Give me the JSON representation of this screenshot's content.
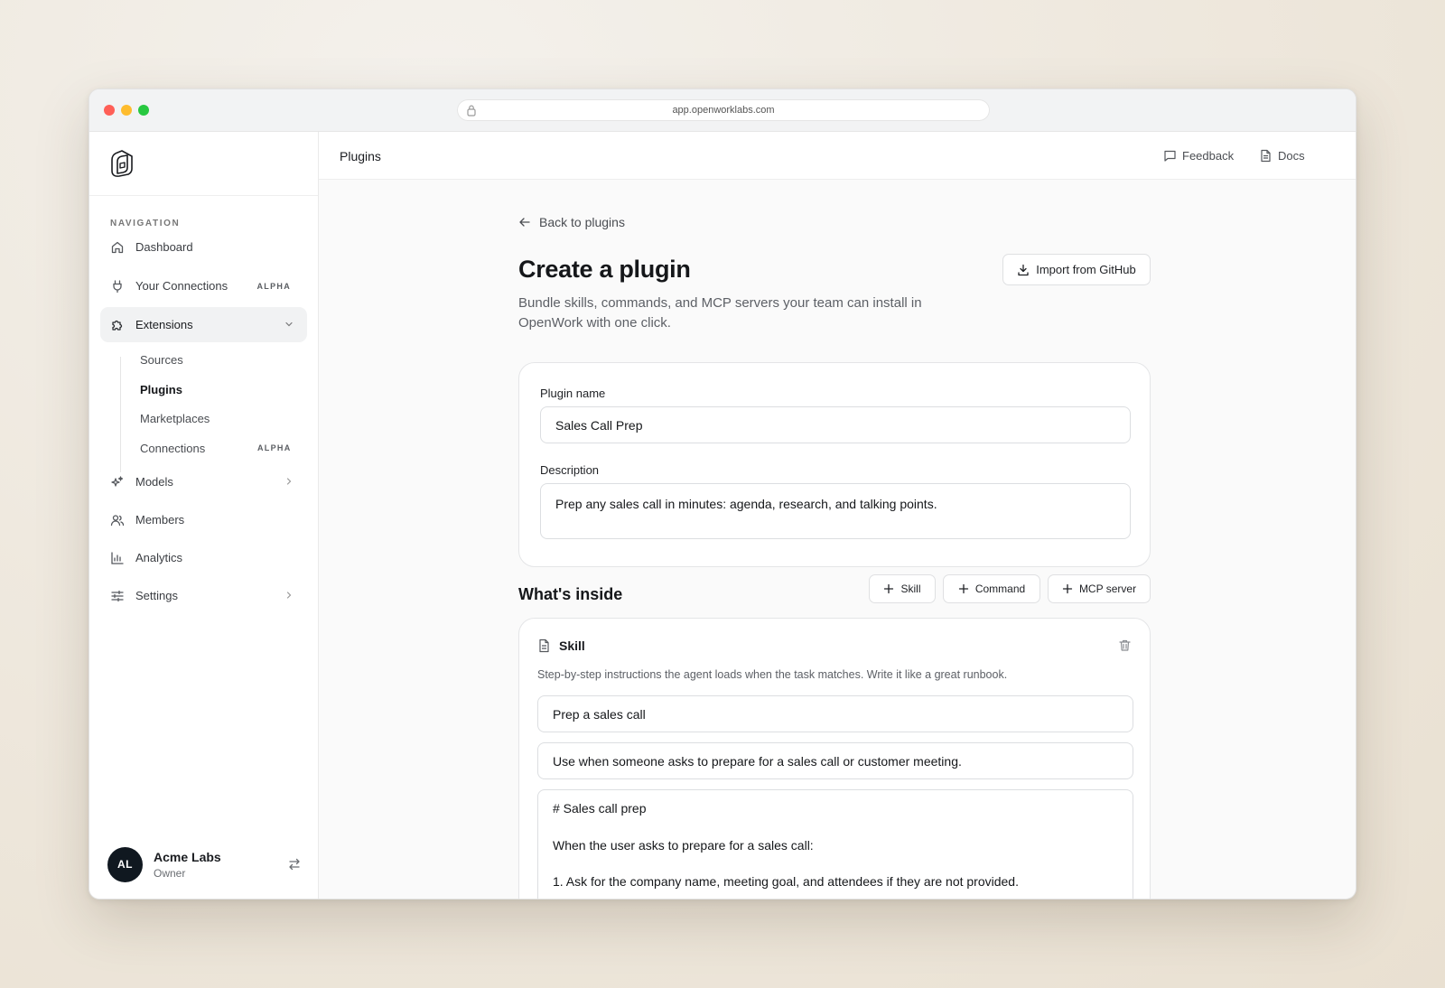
{
  "browser": {
    "url": "app.openworklabs.com"
  },
  "sidebar": {
    "nav_heading": "NAVIGATION",
    "items": [
      {
        "label": "Dashboard",
        "icon": "home-icon"
      },
      {
        "label": "Your Connections",
        "icon": "plug-icon",
        "badge": "ALPHA"
      },
      {
        "label": "Extensions",
        "icon": "puzzle-icon"
      },
      {
        "label": "Models",
        "icon": "sparkles-icon"
      },
      {
        "label": "Members",
        "icon": "users-icon"
      },
      {
        "label": "Analytics",
        "icon": "bar-chart-icon"
      },
      {
        "label": "Settings",
        "icon": "sliders-icon"
      }
    ],
    "sub_items": [
      {
        "label": "Sources"
      },
      {
        "label": "Plugins"
      },
      {
        "label": "Marketplaces"
      },
      {
        "label": "Connections",
        "badge": "ALPHA"
      }
    ],
    "user": {
      "initials": "AL",
      "name": "Acme Labs",
      "role": "Owner"
    }
  },
  "topbar": {
    "title": "Plugins",
    "feedback": "Feedback",
    "docs": "Docs"
  },
  "main": {
    "back_label": "Back to plugins",
    "title": "Create a plugin",
    "subtitle": "Bundle skills, commands, and MCP servers your team can install in OpenWork with one click.",
    "import_button": "Import from GitHub",
    "form": {
      "name_label": "Plugin name",
      "name_value": "Sales Call Prep",
      "description_label": "Description",
      "description_value": "Prep any sales call in minutes: agenda, research, and talking points."
    },
    "inside": {
      "title": "What's inside",
      "add_skill": "Skill",
      "add_command": "Command",
      "add_mcp": "MCP server"
    },
    "skill": {
      "type_label": "Skill",
      "help": "Step-by-step instructions the agent loads when the task matches. Write it like a great runbook.",
      "name_value": "Prep a sales call",
      "when_value": "Use when someone asks to prepare for a sales call or customer meeting.",
      "body_line1": "# Sales call prep",
      "body_line2": "When the user asks to prepare for a sales call:",
      "body_line3": "1. Ask for the company name, meeting goal, and attendees if they are not provided."
    }
  }
}
